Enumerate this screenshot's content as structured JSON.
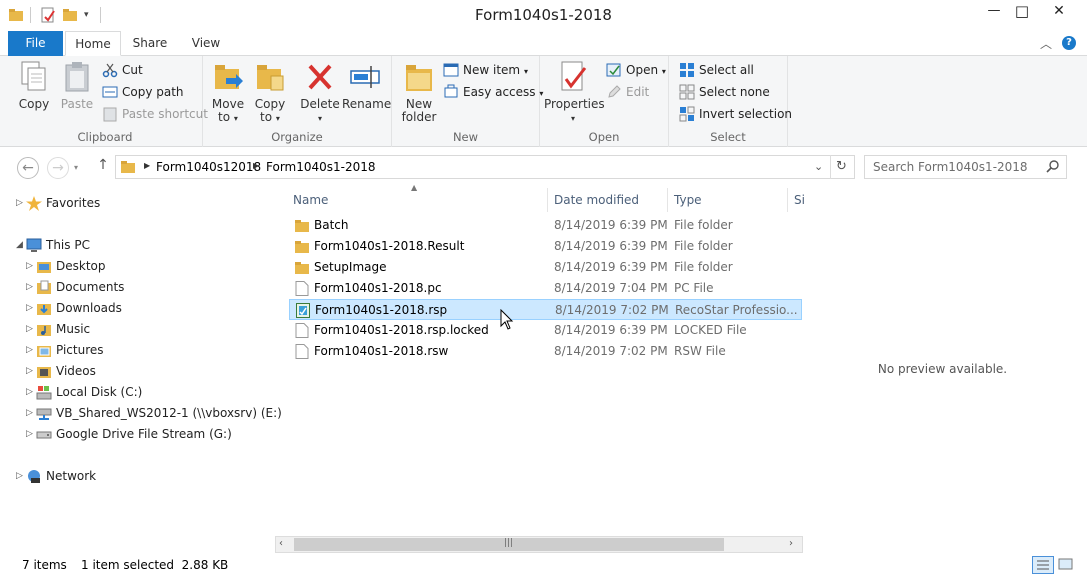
{
  "window": {
    "title": "Form1040s1-2018",
    "controls": {
      "minimize": "—",
      "maximize": "□",
      "close": "✕"
    }
  },
  "ribbon_tabs": [
    {
      "label": "File"
    },
    {
      "label": "Home"
    },
    {
      "label": "Share"
    },
    {
      "label": "View"
    }
  ],
  "ribbon": {
    "clipboard": {
      "label": "Clipboard",
      "copy": "Copy",
      "paste": "Paste",
      "cut": "Cut",
      "copy_path": "Copy path",
      "paste_shortcut": "Paste shortcut"
    },
    "organize": {
      "label": "Organize",
      "move_to_line1": "Move",
      "move_to_line2": "to",
      "copy_to_line1": "Copy",
      "copy_to_line2": "to",
      "delete": "Delete",
      "rename": "Rename"
    },
    "new": {
      "label": "New",
      "new_folder_line1": "New",
      "new_folder_line2": "folder",
      "new_item": "New item",
      "easy_access": "Easy access"
    },
    "open": {
      "label": "Open",
      "properties": "Properties",
      "open": "Open",
      "edit": "Edit"
    },
    "select": {
      "label": "Select",
      "select_all": "Select all",
      "select_none": "Select none",
      "invert_selection": "Invert selection"
    }
  },
  "address": {
    "crumbs": [
      "Form1040s12018",
      "Form1040s1-2018"
    ],
    "search_placeholder": "Search Form1040s1-2018"
  },
  "nav": {
    "favorites": "Favorites",
    "this_pc": "This PC",
    "items": [
      {
        "label": "Desktop",
        "icon": "desktop-folder-icon"
      },
      {
        "label": "Documents",
        "icon": "documents-folder-icon"
      },
      {
        "label": "Downloads",
        "icon": "downloads-folder-icon"
      },
      {
        "label": "Music",
        "icon": "music-folder-icon"
      },
      {
        "label": "Pictures",
        "icon": "pictures-folder-icon"
      },
      {
        "label": "Videos",
        "icon": "videos-folder-icon"
      },
      {
        "label": "Local Disk (C:)",
        "icon": "local-disk-icon"
      },
      {
        "label": "VB_Shared_WS2012-1 (\\\\vboxsrv) (E:)",
        "icon": "network-drive-icon"
      },
      {
        "label": "Google Drive File Stream (G:)",
        "icon": "drive-icon"
      }
    ],
    "network": "Network"
  },
  "columns": {
    "name": "Name",
    "date": "Date modified",
    "type": "Type",
    "size": "Si"
  },
  "files": [
    {
      "name": "Batch",
      "date": "8/14/2019 6:39 PM",
      "type": "File folder",
      "kind": "folder"
    },
    {
      "name": "Form1040s1-2018.Result",
      "date": "8/14/2019 6:39 PM",
      "type": "File folder",
      "kind": "folder"
    },
    {
      "name": "SetupImage",
      "date": "8/14/2019 6:39 PM",
      "type": "File folder",
      "kind": "folder"
    },
    {
      "name": "Form1040s1-2018.pc",
      "date": "8/14/2019 7:04 PM",
      "type": "PC File",
      "kind": "file"
    },
    {
      "name": "Form1040s1-2018.rsp",
      "date": "8/14/2019 7:02 PM",
      "type": "RecoStar Professio...",
      "kind": "rsp",
      "selected": true
    },
    {
      "name": "Form1040s1-2018.rsp.locked",
      "date": "8/14/2019 6:39 PM",
      "type": "LOCKED File",
      "kind": "file"
    },
    {
      "name": "Form1040s1-2018.rsw",
      "date": "8/14/2019 7:02 PM",
      "type": "RSW File",
      "kind": "file"
    }
  ],
  "preview": {
    "text": "No preview available."
  },
  "status": {
    "items": "7 items",
    "selection": "1 item selected  2.88 KB"
  },
  "colors": {
    "accent": "#1979ca",
    "selection": "#cce8ff",
    "folder": "#e8b84a"
  }
}
